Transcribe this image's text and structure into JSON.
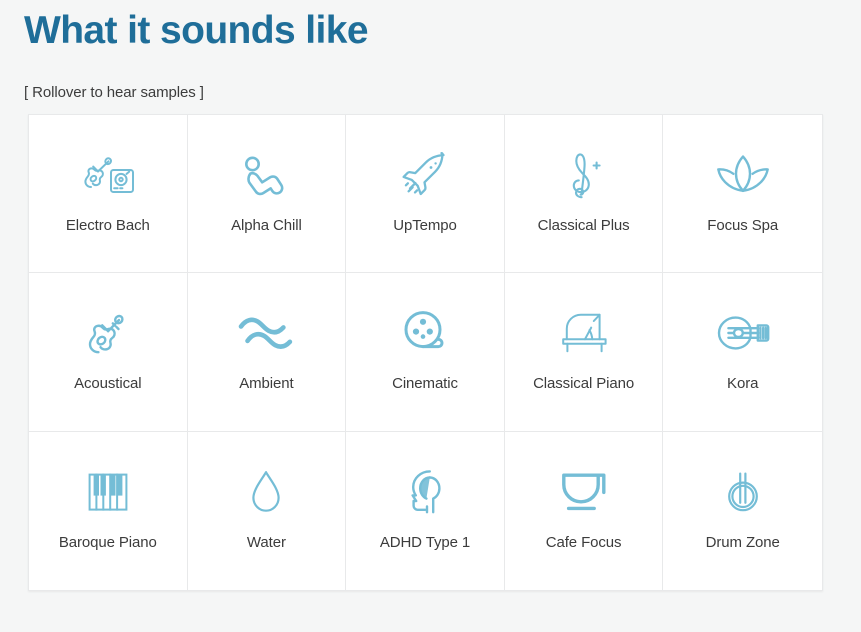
{
  "header": {
    "title": "What it sounds like",
    "subtitle": "[ Rollover to hear samples ]"
  },
  "colors": {
    "title": "#1f6e99",
    "icon": "#74bdd6",
    "label": "#3c3c3c",
    "page_background": "#f5f6f6",
    "cell_background": "#ffffff",
    "cell_border": "#e8e9ea"
  },
  "grid": {
    "columns": 5,
    "rows": 3,
    "cells": [
      {
        "label": "Electro Bach",
        "icon": "violin-turntable-icon"
      },
      {
        "label": "Alpha Chill",
        "icon": "reclining-person-icon"
      },
      {
        "label": "UpTempo",
        "icon": "rocket-icon"
      },
      {
        "label": "Classical Plus",
        "icon": "treble-clef-plus-icon"
      },
      {
        "label": "Focus Spa",
        "icon": "lotus-flower-icon"
      },
      {
        "label": "Acoustical",
        "icon": "acoustic-guitar-icon"
      },
      {
        "label": "Ambient",
        "icon": "double-wave-icon"
      },
      {
        "label": "Cinematic",
        "icon": "film-reel-icon"
      },
      {
        "label": "Classical Piano",
        "icon": "grand-piano-icon"
      },
      {
        "label": "Kora",
        "icon": "lute-icon"
      },
      {
        "label": "Baroque Piano",
        "icon": "piano-keys-icon"
      },
      {
        "label": "Water",
        "icon": "water-droplet-icon"
      },
      {
        "label": "ADHD Type 1",
        "icon": "head-brain-icon"
      },
      {
        "label": "Cafe Focus",
        "icon": "coffee-cup-icon"
      },
      {
        "label": "Drum Zone",
        "icon": "drum-icon"
      }
    ]
  }
}
